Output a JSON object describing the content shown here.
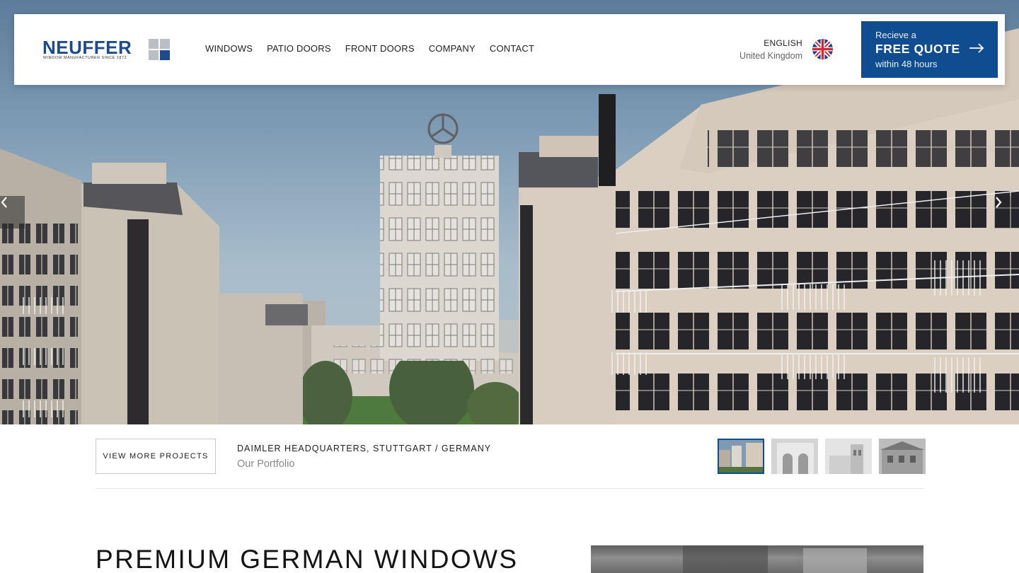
{
  "header": {
    "logo": {
      "wordmark": "NEUFFER",
      "tagline": "WINDOW MANUFACTURER SINCE 1872"
    },
    "nav": [
      {
        "label": "WINDOWS"
      },
      {
        "label": "PATIO DOORS"
      },
      {
        "label": "FRONT DOORS"
      },
      {
        "label": "COMPANY"
      },
      {
        "label": "CONTACT"
      }
    ],
    "language": {
      "name": "ENGLISH",
      "region": "United Kingdom",
      "flag_icon": "uk-flag-icon"
    },
    "quote_cta": {
      "line1": "Recieve a",
      "line2": "FREE QUOTE",
      "line3": "within 48 hours",
      "icon": "arrow-right-icon"
    }
  },
  "hero": {
    "prev_icon": "chevron-left-icon",
    "next_icon": "chevron-right-icon"
  },
  "project_bar": {
    "button_label": "VIEW MORE PROJECTS",
    "project_title": "DAIMLER HEADQUARTERS, STUTTGART / GERMANY",
    "project_subtitle": "Our Portfolio",
    "thumbnails_count": 4,
    "active_thumbnail": 1
  },
  "content": {
    "headline": "PREMIUM GERMAN WINDOWS"
  },
  "colors": {
    "brand_blue": "#0f4c90",
    "logo_blue": "#1c4a8c",
    "text_dark": "#1d1d1d",
    "text_muted": "#8a8a8a"
  }
}
